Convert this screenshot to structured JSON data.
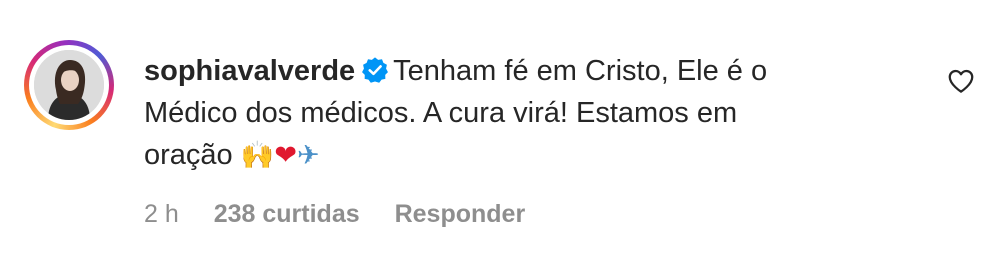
{
  "comment": {
    "username": "sophiavalverde",
    "verified": true,
    "text_lines": [
      "Tenham fé em Cristo, Ele é o",
      "Médico dos médicos. A cura virá! Estamos em",
      "oração"
    ],
    "emojis": [
      "🙌",
      "❤",
      "✈"
    ],
    "time": "2 h",
    "likes": "238 curtidas",
    "reply_label": "Responder"
  },
  "icons": {
    "verified": "verified-badge-icon",
    "like": "heart-outline-icon"
  },
  "colors": {
    "text": "#262626",
    "muted": "#8e8e8e",
    "verified_blue": "#0095f6",
    "heart_red": "#e0182f"
  }
}
